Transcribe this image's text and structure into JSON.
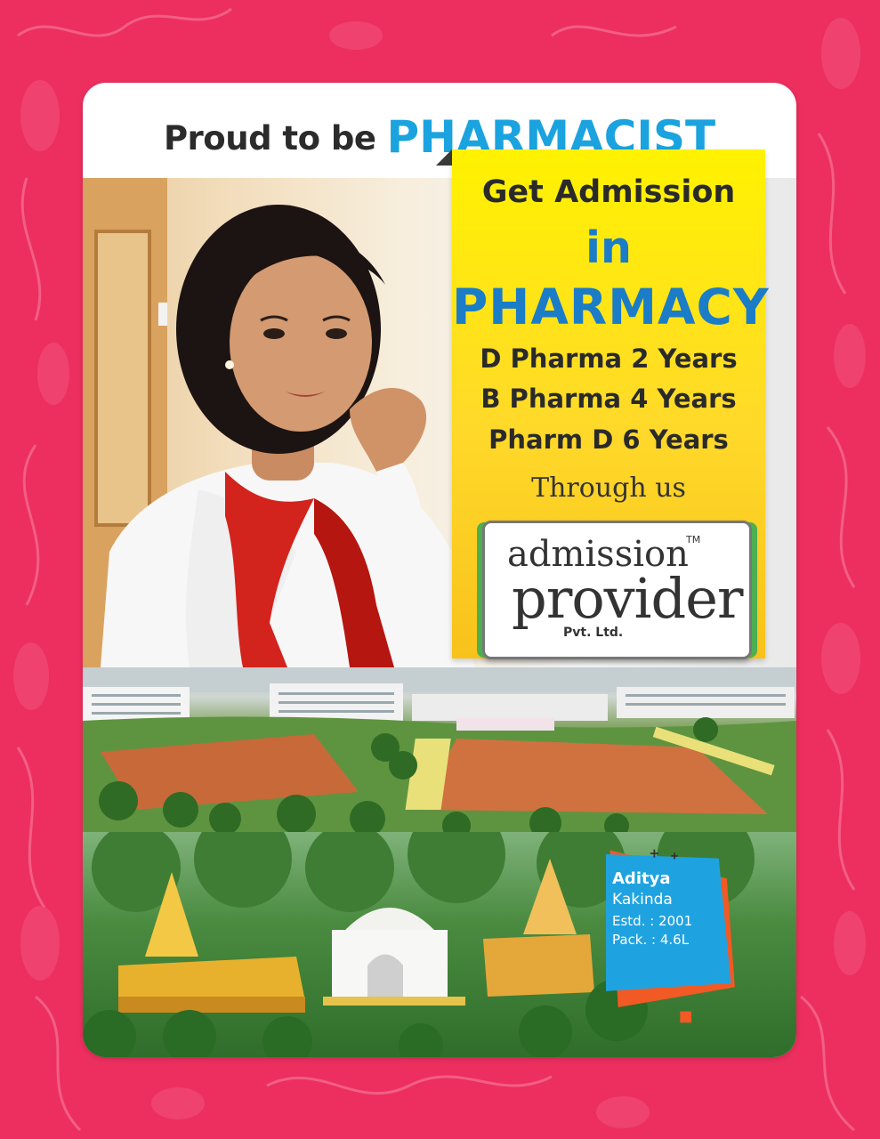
{
  "headline": {
    "lead": "Proud to be",
    "emphasis": "PHARMACIST"
  },
  "offer": {
    "line1": "Get Admission",
    "line2": "in",
    "line3": "PHARMACY",
    "courses": [
      "D Pharma 2 Years",
      "B Pharma 4 Years",
      "Pharm D 6 Years"
    ],
    "through": "Through us"
  },
  "logo": {
    "word1": "admission",
    "word2": "provider",
    "suffix": "Pvt. Ltd.",
    "tm": "TM"
  },
  "college": {
    "name": "Aditya",
    "location": "Kakinda",
    "established": "Estd. : 2001",
    "package": "Pack. : 4.6L"
  },
  "colors": {
    "background": "#ec2f5f",
    "accent_blue": "#1aa3df",
    "yellow": "#ffe11a",
    "orange": "#f15a24"
  }
}
